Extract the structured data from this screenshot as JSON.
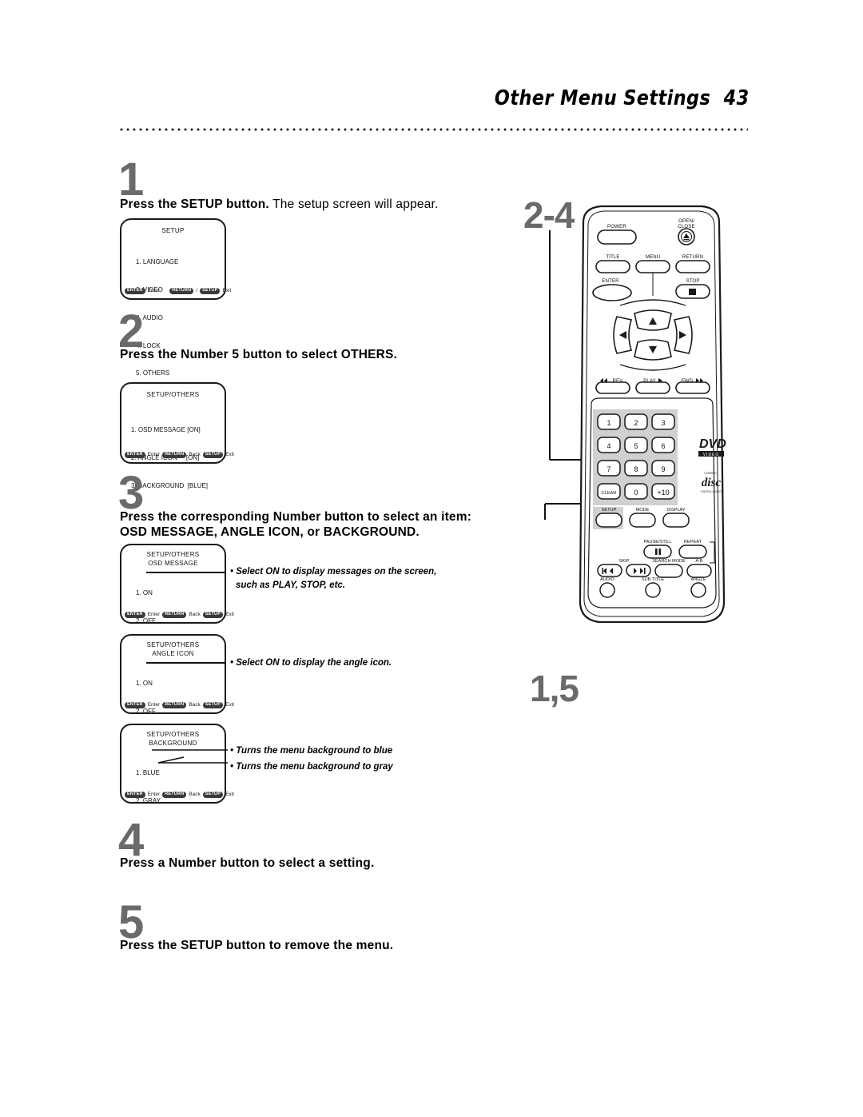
{
  "header": {
    "title": "Other Menu Settings",
    "page_number": "43"
  },
  "steps": [
    {
      "number": "1",
      "bold_text": "Press the SETUP button.",
      "normal_text": " The setup screen will appear."
    },
    {
      "number": "2",
      "bold_text": "Press the Number 5 button to select OTHERS."
    },
    {
      "number": "3",
      "bold_text": "Press the corresponding Number button to select an item:",
      "bold_text_line2": "OSD MESSAGE, ANGLE ICON, or BACKGROUND."
    },
    {
      "number": "4",
      "bold_text": "Press a Number button to select a setting."
    },
    {
      "number": "5",
      "bold_text": "Press the SETUP button to remove the menu."
    }
  ],
  "screens": {
    "setup": {
      "title": "SETUP",
      "items": [
        "1. LANGUAGE",
        "2. VIDEO",
        "3. AUDIO",
        "4. LOCK",
        "5. OTHERS"
      ],
      "footer": {
        "enter_key": "ENTER",
        "enter_word": "Enter",
        "return_key": "RETURN",
        "separator": "/",
        "setup_key": "SETUP",
        "exit_word": "Exit"
      }
    },
    "others": {
      "title": "SETUP/OTHERS",
      "items": [
        "1. OSD MESSAGE [ON]",
        "2. ANGLE ICON     [ON]",
        "3. BACKGROUND  [BLUE]"
      ],
      "footer": {
        "enter_key": "ENTER",
        "enter_word": "Enter",
        "return_key": "RETURN",
        "back_word": "Back",
        "setup_key": "SETUP",
        "exit_word": "Exit"
      }
    },
    "osd_message": {
      "title": "SETUP/OTHERS",
      "subtitle": "OSD MESSAGE",
      "items": [
        "1. ON",
        "2. OFF"
      ],
      "footer": {
        "enter_key": "ENTER",
        "enter_word": "Enter",
        "return_key": "RETURN",
        "back_word": "Back",
        "setup_key": "SETUP",
        "exit_word": "Exit"
      },
      "annotation_line1": "• Select ON to display messages on the screen,",
      "annotation_line2": "such as PLAY, STOP, etc."
    },
    "angle_icon": {
      "title": "SETUP/OTHERS",
      "subtitle": "ANGLE ICON",
      "items": [
        "1. ON",
        "2. OFF"
      ],
      "footer": {
        "enter_key": "ENTER",
        "enter_word": "Enter",
        "return_key": "RETURN",
        "back_word": "Back",
        "setup_key": "SETUP",
        "exit_word": "Exit"
      },
      "annotation_line1": "• Select ON to display the angle icon."
    },
    "background": {
      "title": "SETUP/OTHERS",
      "subtitle": "BACKGROUND",
      "items": [
        "1. BLUE",
        "2. GRAY"
      ],
      "footer": {
        "enter_key": "ENTER",
        "enter_word": "Enter",
        "return_key": "RETURN",
        "back_word": "Back",
        "setup_key": "SETUP",
        "exit_word": "Exit"
      },
      "annotation_line1": "• Turns the menu background to blue",
      "annotation_line2": "• Turns the menu background to gray"
    }
  },
  "callouts": {
    "top": "2-4",
    "bottom": "1,5"
  },
  "remote": {
    "buttons": {
      "power": "POWER",
      "open_close_line1": "OPEN/",
      "open_close_line2": "CLOSE",
      "title": "TITLE",
      "menu": "MENU",
      "return": "RETURN",
      "enter": "ENTER",
      "stop": "STOP",
      "rev": "REV",
      "play": "PLAY",
      "fwd": "FWD",
      "clear": "CLEAR",
      "plus_ten": "+10",
      "setup": "SETUP",
      "mode": "MODE",
      "display": "DISPLAY",
      "pause_still": "PAUSE/STILL",
      "repeat": "REPEAT",
      "skip": "SKIP",
      "search_mode": "SEARCH MODE",
      "a_b": "A-B",
      "audio": "AUDIO",
      "sub_title": "SUB TITLE",
      "angle": "ANGLE"
    },
    "numbers": [
      "1",
      "2",
      "3",
      "4",
      "5",
      "6",
      "7",
      "8",
      "9",
      "0"
    ],
    "logos": {
      "dvd_main": "DVD",
      "dvd_sub": "VIDEO",
      "cd_top": "COMPACT",
      "cd_main": "disc",
      "cd_sub": "DIGITAL AUDIO"
    }
  },
  "colors": {
    "callout_gray": "#6a6a6a",
    "highlight_gray": "#d0d0d0",
    "outline": "#1a1a1a"
  }
}
